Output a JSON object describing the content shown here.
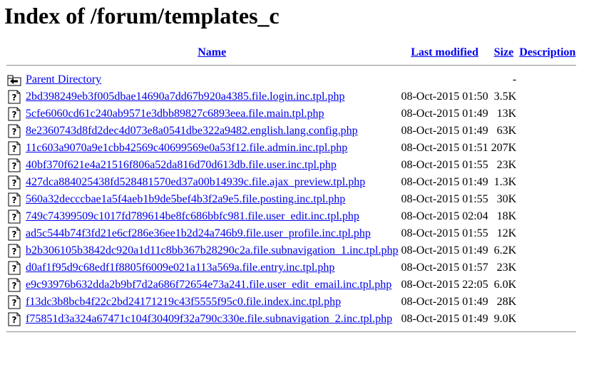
{
  "page": {
    "title": "Index of /forum/templates_c"
  },
  "columns": {
    "name": "Name",
    "modified": "Last modified",
    "size": "Size",
    "description": "Description"
  },
  "parent": {
    "name": "Parent Directory",
    "modified": "",
    "size": "-",
    "icon": "back-arrow-icon"
  },
  "files": [
    {
      "name": "2bd398249eb3f005dbae14690a7dd67b920a4385.file.login.inc.tpl.php",
      "modified": "08-Oct-2015 01:50",
      "size": "3.5K",
      "icon": "unknown-file-icon"
    },
    {
      "name": "5cfe6060cd61c240ab9571e3dbb89827c6893eea.file.main.tpl.php",
      "modified": "08-Oct-2015 01:49",
      "size": "13K",
      "icon": "unknown-file-icon"
    },
    {
      "name": "8e2360743d8fd2dec4d073e8a0541dbe322a9482.english.lang.config.php",
      "modified": "08-Oct-2015 01:49",
      "size": "63K",
      "icon": "unknown-file-icon"
    },
    {
      "name": "11c603a9070a9e1cbb42569c40699569e0a53f12.file.admin.inc.tpl.php",
      "modified": "08-Oct-2015 01:51",
      "size": "207K",
      "icon": "unknown-file-icon"
    },
    {
      "name": "40bf370f621e4a21516f806a52da816d70d613db.file.user.inc.tpl.php",
      "modified": "08-Oct-2015 01:55",
      "size": "23K",
      "icon": "unknown-file-icon"
    },
    {
      "name": "427dca884025438fd528481570ed37a00b14939c.file.ajax_preview.tpl.php",
      "modified": "08-Oct-2015 01:49",
      "size": "1.3K",
      "icon": "unknown-file-icon"
    },
    {
      "name": "560a32decccbae1a5f4aeb1b9de5bef4b3f2a9e5.file.posting.inc.tpl.php",
      "modified": "08-Oct-2015 01:55",
      "size": "30K",
      "icon": "unknown-file-icon"
    },
    {
      "name": "749c74399509c1017fd789614be8fc686bbfc981.file.user_edit.inc.tpl.php",
      "modified": "08-Oct-2015 02:04",
      "size": "18K",
      "icon": "unknown-file-icon"
    },
    {
      "name": "ad5c544b74f3fd21e6cf286e36ee1b2d24a746b9.file.user_profile.inc.tpl.php",
      "modified": "08-Oct-2015 01:55",
      "size": "12K",
      "icon": "unknown-file-icon"
    },
    {
      "name": "b2b306105b3842dc920a1d11c8bb367b28290c2a.file.subnavigation_1.inc.tpl.php",
      "modified": "08-Oct-2015 01:49",
      "size": "6.2K",
      "icon": "unknown-file-icon"
    },
    {
      "name": "d0af1f95d9c68edf1f8805f6009e021a113a569a.file.entry.inc.tpl.php",
      "modified": "08-Oct-2015 01:57",
      "size": "23K",
      "icon": "unknown-file-icon"
    },
    {
      "name": "e9c93976b632dda2b9bf7d2a686f72654e73a241.file.user_edit_email.inc.tpl.php",
      "modified": "08-Oct-2015 22:05",
      "size": "6.0K",
      "icon": "unknown-file-icon"
    },
    {
      "name": "f13dc3b8bcb4f22c2bd24171219c43f5555f95c0.file.index.inc.tpl.php",
      "modified": "08-Oct-2015 01:49",
      "size": "28K",
      "icon": "unknown-file-icon"
    },
    {
      "name": "f75851d3a324a67471c104f30409f32a790c330e.file.subnavigation_2.inc.tpl.php",
      "modified": "08-Oct-2015 01:49",
      "size": "9.0K",
      "icon": "unknown-file-icon"
    }
  ],
  "colors": {
    "link": "#0000ee",
    "text": "#000000",
    "background": "#ffffff"
  }
}
